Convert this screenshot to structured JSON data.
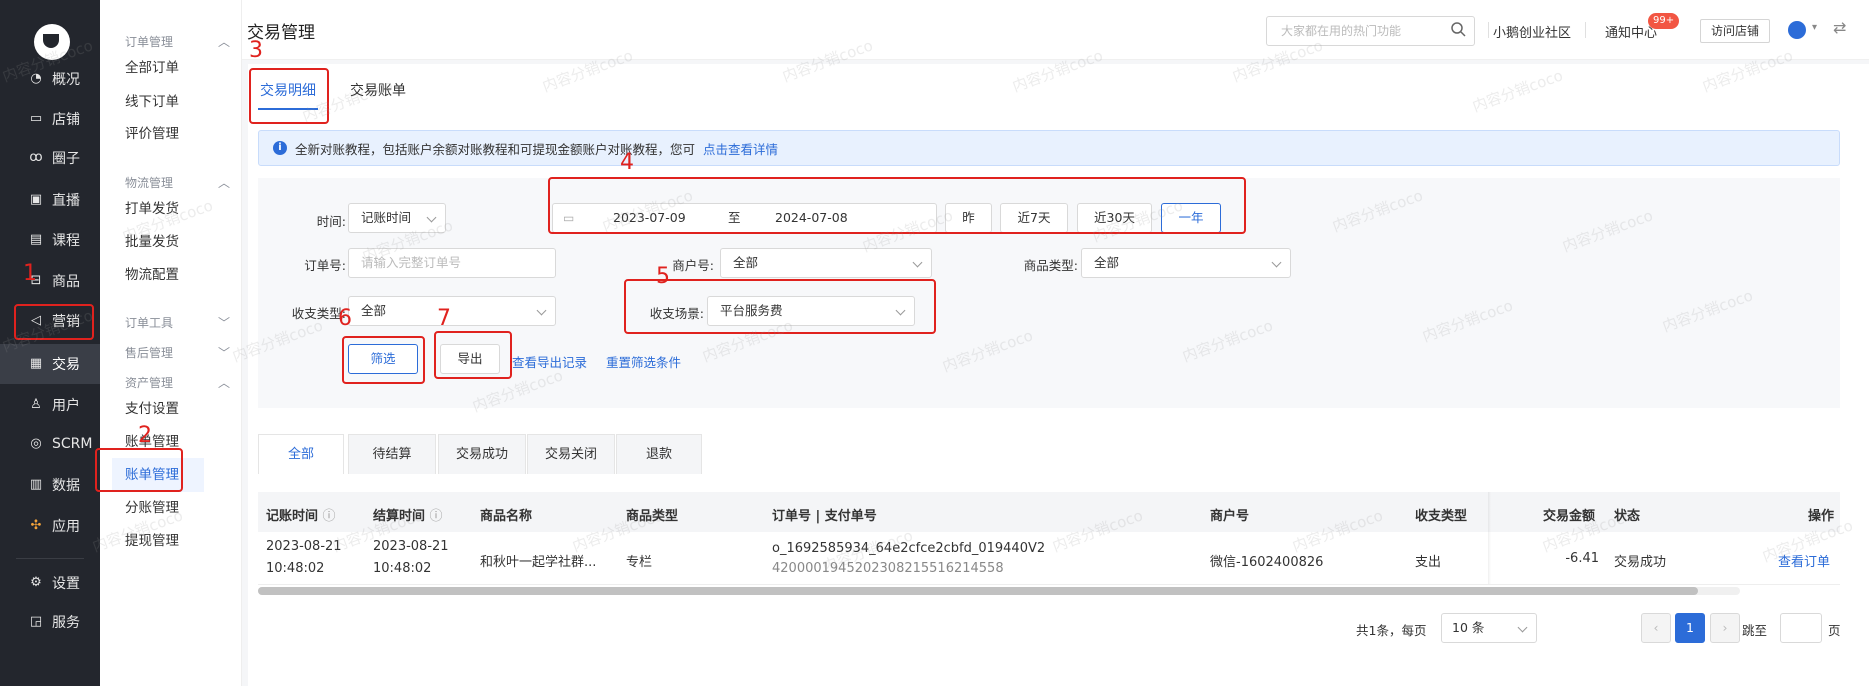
{
  "rail": {
    "items": [
      {
        "label": "概况",
        "icon": "pie-chart-icon"
      },
      {
        "label": "店铺",
        "icon": "store-icon"
      },
      {
        "label": "圈子",
        "icon": "group-icon"
      },
      {
        "label": "直播",
        "icon": "live-icon"
      },
      {
        "label": "课程",
        "icon": "course-icon"
      },
      {
        "label": "商品",
        "icon": "goods-icon"
      },
      {
        "label": "营销",
        "icon": "megaphone-icon"
      },
      {
        "label": "交易",
        "icon": "trade-icon"
      },
      {
        "label": "用户",
        "icon": "user-icon"
      },
      {
        "label": "SCRM",
        "icon": "scrm-icon"
      },
      {
        "label": "数据",
        "icon": "data-icon"
      },
      {
        "label": "应用",
        "icon": "apps-icon"
      },
      {
        "label": "设置",
        "icon": "gear-icon"
      },
      {
        "label": "服务",
        "icon": "service-icon"
      }
    ]
  },
  "subnav": {
    "groups": [
      "订单管理",
      "物流管理",
      "订单工具",
      "售后管理",
      "资产管理"
    ],
    "items": [
      "全部订单",
      "线下订单",
      "评价管理",
      "打单发货",
      "批量发货",
      "物流配置",
      "支付设置",
      "账单管理",
      "账单管理",
      "分账管理",
      "提现管理"
    ]
  },
  "header": {
    "title": "交易管理",
    "search_placeholder": "大家都在用的热门功能",
    "community": "小鹅创业社区",
    "notify": "通知中心",
    "badge": "99+",
    "visit": "访问店铺"
  },
  "tabs": [
    "交易明细",
    "交易账单"
  ],
  "notice": {
    "text": "全新对账教程，包括账户余额对账教程和可提现金额账户对账教程，您可",
    "link": "点击查看详情"
  },
  "filters": {
    "time_label": "时间:",
    "time_type": "记账时间",
    "date_from": "2023-07-09",
    "date_sep": "至",
    "date_to": "2024-07-08",
    "quick": [
      "昨",
      "近7天",
      "近30天",
      "一年"
    ],
    "order_label": "订单号:",
    "order_placeholder": "请输入完整订单号",
    "merchant_label": "商户号:",
    "merchant_value": "全部",
    "goods_type_label": "商品类型:",
    "goods_type_value": "全部",
    "io_type_label": "收支类型:",
    "io_type_value": "全部",
    "scene_label": "收支场景:",
    "scene_value": "平台服务费",
    "filter_btn": "筛选",
    "export_btn": "导出",
    "export_records": "查看导出记录",
    "reset": "重置筛选条件"
  },
  "annotations": [
    "1",
    "2",
    "3",
    "4",
    "5",
    "6",
    "7"
  ],
  "status_tabs": [
    "全部",
    "待结算",
    "交易成功",
    "交易关闭",
    "退款"
  ],
  "table": {
    "headers": [
      "记账时间",
      "结算时间",
      "商品名称",
      "商品类型",
      "订单号 | 支付单号",
      "商户号",
      "收支类型",
      "交易金额",
      "状态",
      "操作"
    ],
    "rows": [
      {
        "book_date": "2023-08-21",
        "book_time": "10:48:02",
        "settle_date": "2023-08-21",
        "settle_time": "10:48:02",
        "goods_name": "和秋叶一起学社群...",
        "goods_type": "专栏",
        "order_no": "o_1692585934_64e2cfce2cbfd_019440V2",
        "pay_no": "4200001945202308215516214558",
        "merchant": "微信-1602400826",
        "io_type": "支出",
        "amount": "-6.41",
        "status": "交易成功",
        "action": "查看订单"
      }
    ]
  },
  "pager": {
    "total": "共1条，每页",
    "size": "10 条",
    "page": "1",
    "goto": "跳至",
    "unit": "页"
  },
  "watermark": "内容分销coco",
  "colors": {
    "accent": "#2c6cd8",
    "annotation": "#e0221e",
    "rail": "#23262d"
  }
}
